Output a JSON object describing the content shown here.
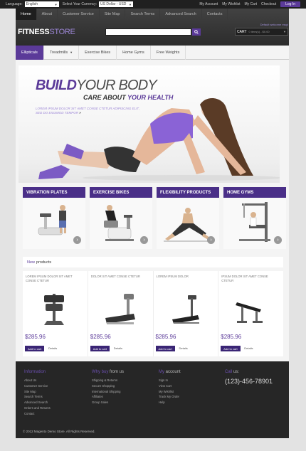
{
  "topbar": {
    "language_label": "Language:",
    "language_value": "English",
    "currency_label": "Select Your Currency:",
    "currency_value": "US Dollar - USD",
    "links": [
      "My Account",
      "My Wishlist",
      "My Cart",
      "Checkout"
    ],
    "login": "Log In"
  },
  "nav": [
    "Home",
    "About",
    "Customer Service",
    "Site Map",
    "Search Terms",
    "Advanced Search",
    "Contacts"
  ],
  "logo": {
    "part1": "FITNESS",
    "part2": "STORE"
  },
  "search": {
    "placeholder": ""
  },
  "welcome": "Default welcome msg!",
  "cart": {
    "label": "CART",
    "count": "0 item(s) - $0.00"
  },
  "categories": [
    "Ellipticals",
    "Treadmills",
    "Exercise Bikes",
    "Home Gyms",
    "Free Weights"
  ],
  "hero": {
    "title1": "BUILD",
    "title2": "YOUR BODY",
    "subtitle1": "CARE ABOUT ",
    "subtitle2": "YOUR HEALTH",
    "text": "LOREM IPSUM DOLOR SIT AMET CONSE CTETUR ADIPISCING ELIT, SED DO EIUSMOD TEMPOR",
    "more": "»"
  },
  "category_blocks": [
    {
      "title": "VIBRATION PLATES"
    },
    {
      "title": "EXERCISE BIKES"
    },
    {
      "title": "FLEXIBILITY PRODUCTS"
    },
    {
      "title": "HOME GYMS"
    }
  ],
  "new_products": {
    "label1": "New",
    "label2": "products"
  },
  "products": [
    {
      "name": "LOREM IPSUM DOLOR SIT AMET CONSE CTETUR",
      "price": "$285.96",
      "add": "Add to cart",
      "details": "Details"
    },
    {
      "name": "DOLOR SIT AMET CONSE CTETUR",
      "price": "$285.96",
      "add": "Add to cart",
      "details": "Details"
    },
    {
      "name": "LOREM IPSUM DOLOR",
      "price": "$285.96",
      "add": "Add to cart",
      "details": "Details"
    },
    {
      "name": "IPSUM DOLOR SIT AMET CONSE CTETUR",
      "price": "$285.96",
      "add": "Add to cart",
      "details": "Details"
    }
  ],
  "footer": {
    "info": {
      "title": "Information",
      "links": [
        "About Us",
        "Customer Service",
        "Site Map",
        "Search Terms",
        "Advanced Search",
        "Orders and Returns",
        "Contact"
      ]
    },
    "why": {
      "title1": "Why buy",
      "title2": " from us",
      "links": [
        "Shipping & Returns",
        "Secure Shopping",
        "International Shipping",
        "Affiliates",
        "Group Sales"
      ]
    },
    "account": {
      "title1": "My",
      "title2": " account",
      "links": [
        "Sign In",
        "View Cart",
        "My Wishlist",
        "Track My Order",
        "Help"
      ]
    },
    "call": {
      "title1": "Call",
      "title2": " us:",
      "phone": "(123)-456-78901"
    },
    "copyright": "© 2012 Magento Demo Store. All Rights Reserved."
  },
  "colors": {
    "accent": "#5b3a99",
    "dark": "#262626"
  }
}
